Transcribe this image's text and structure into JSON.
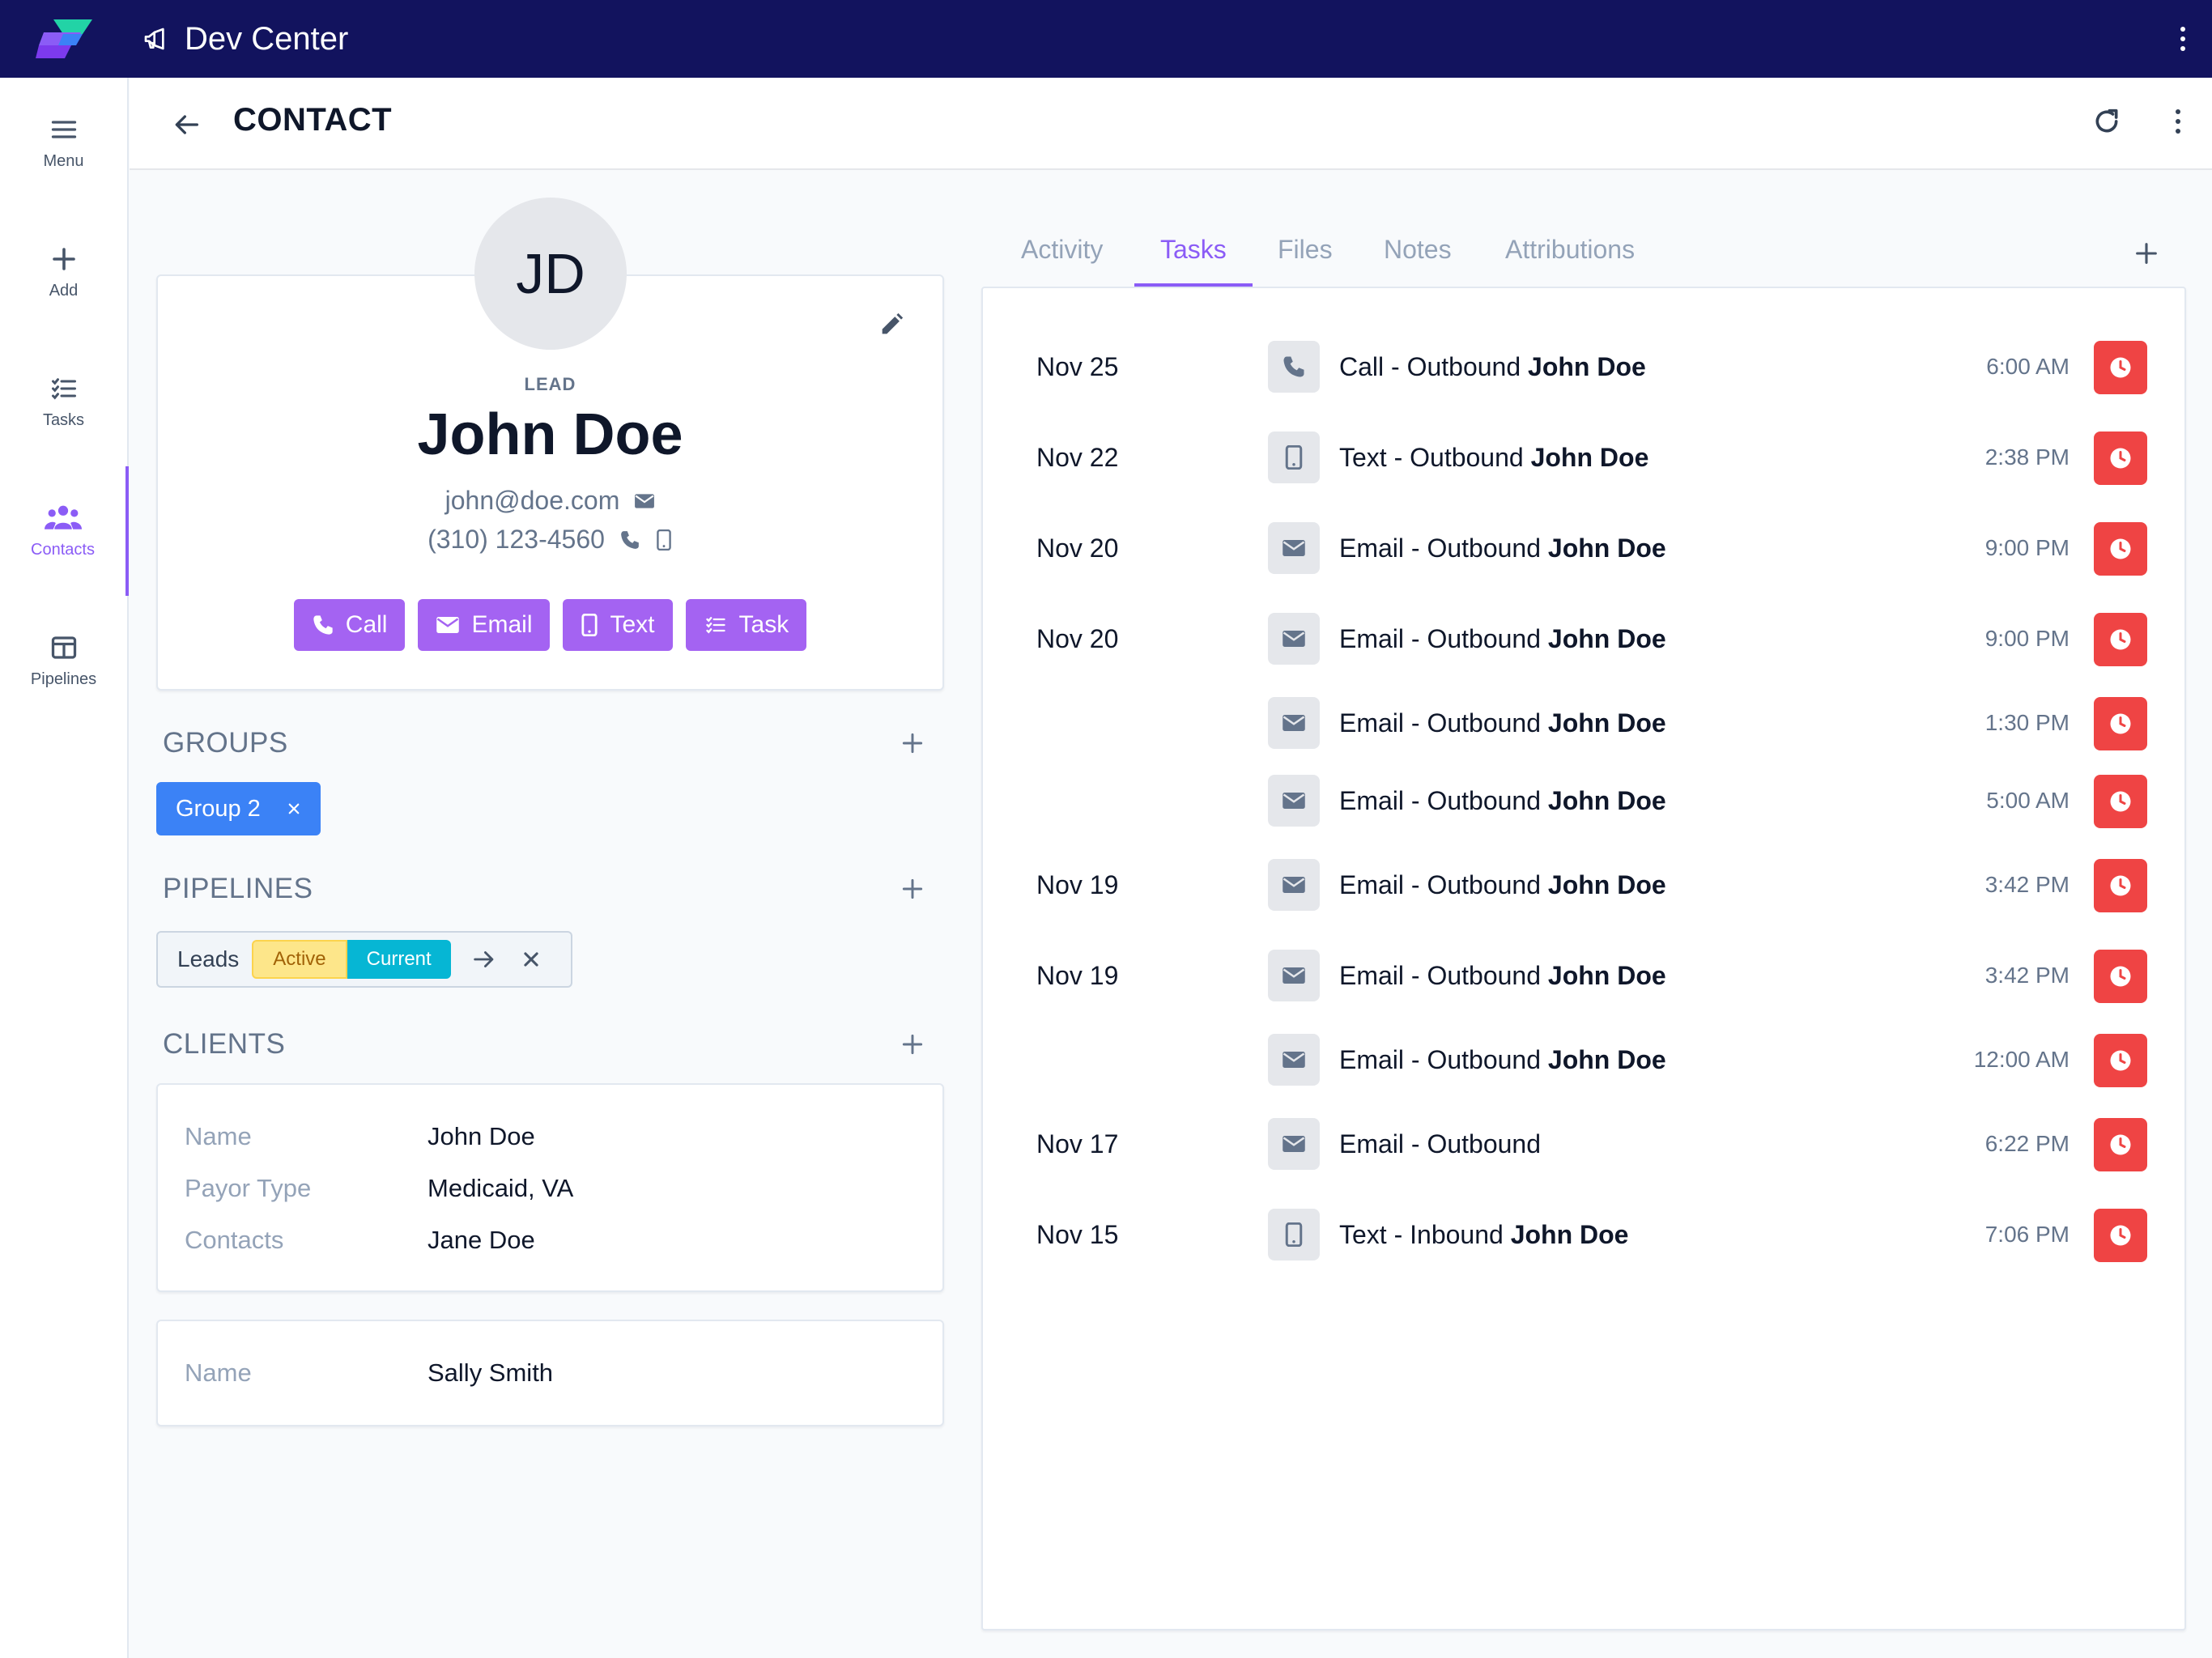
{
  "app": {
    "title": "Dev Center",
    "accent": "#8b5cf6",
    "topbar_color": "#12135e"
  },
  "nav": {
    "items": [
      {
        "label": "Menu",
        "icon": "menu-icon",
        "active": false
      },
      {
        "label": "Add",
        "icon": "plus-icon",
        "active": false
      },
      {
        "label": "Tasks",
        "icon": "tasks-icon",
        "active": false
      },
      {
        "label": "Contacts",
        "icon": "contacts-icon",
        "active": true
      },
      {
        "label": "Pipelines",
        "icon": "pipelines-icon",
        "active": false
      }
    ]
  },
  "page": {
    "title": "CONTACT"
  },
  "contact": {
    "initials": "JD",
    "status": "LEAD",
    "name": "John Doe",
    "email": "john@doe.com",
    "phone": "(310) 123-4560",
    "actions": [
      {
        "label": "Call",
        "icon": "phone-icon"
      },
      {
        "label": "Email",
        "icon": "mail-icon"
      },
      {
        "label": "Text",
        "icon": "mobile-icon"
      },
      {
        "label": "Task",
        "icon": "tasks-icon"
      }
    ]
  },
  "groups": {
    "title": "GROUPS",
    "items": [
      {
        "label": "Group 2"
      }
    ]
  },
  "pipelines": {
    "title": "PIPELINES",
    "items": [
      {
        "name": "Leads",
        "stage": "Active",
        "status": "Current"
      }
    ]
  },
  "clients": {
    "title": "CLIENTS",
    "cards": [
      {
        "fields": [
          {
            "key": "Name",
            "value": "John Doe"
          },
          {
            "key": "Payor Type",
            "value": "Medicaid, VA"
          },
          {
            "key": "Contacts",
            "value": "Jane Doe"
          }
        ]
      },
      {
        "fields": [
          {
            "key": "Name",
            "value": "Sally Smith"
          }
        ]
      }
    ]
  },
  "tabs": [
    {
      "label": "Activity",
      "active": false
    },
    {
      "label": "Tasks",
      "active": true
    },
    {
      "label": "Files",
      "active": false
    },
    {
      "label": "Notes",
      "active": false
    },
    {
      "label": "Attributions",
      "active": false
    }
  ],
  "tasks": [
    {
      "date": "Nov 25",
      "icon": "phone-icon",
      "text": "Call - Outbound",
      "contact": "John Doe",
      "time": "6:00 AM"
    },
    {
      "date": "Nov 22",
      "icon": "mobile-icon",
      "text": "Text - Outbound",
      "contact": "John Doe",
      "time": "2:38 PM"
    },
    {
      "date": "Nov 20",
      "icon": "mail-icon",
      "text": "Email - Outbound",
      "contact": "John Doe",
      "time": "9:00 PM"
    },
    {
      "date": "Nov 20",
      "icon": "mail-icon",
      "text": "Email - Outbound",
      "contact": "John Doe",
      "time": "9:00 PM"
    },
    {
      "date": "",
      "icon": "mail-icon",
      "text": "Email - Outbound",
      "contact": "John Doe",
      "time": "1:30 PM"
    },
    {
      "date": "",
      "icon": "mail-icon",
      "text": "Email - Outbound",
      "contact": "John Doe",
      "time": "5:00 AM"
    },
    {
      "date": "Nov 19",
      "icon": "mail-icon",
      "text": "Email - Outbound",
      "contact": "John Doe",
      "time": "3:42 PM"
    },
    {
      "date": "Nov 19",
      "icon": "mail-icon",
      "text": "Email - Outbound",
      "contact": "John Doe",
      "time": "3:42 PM"
    },
    {
      "date": "",
      "icon": "mail-icon",
      "text": "Email - Outbound",
      "contact": "John Doe",
      "time": "12:00 AM"
    },
    {
      "date": "Nov 17",
      "icon": "mail-icon",
      "text": "Email - Outbound",
      "contact": "",
      "time": "6:22 PM"
    },
    {
      "date": "Nov 15",
      "icon": "mobile-icon",
      "text": "Text - Inbound",
      "contact": "John Doe",
      "time": "7:06 PM"
    }
  ]
}
